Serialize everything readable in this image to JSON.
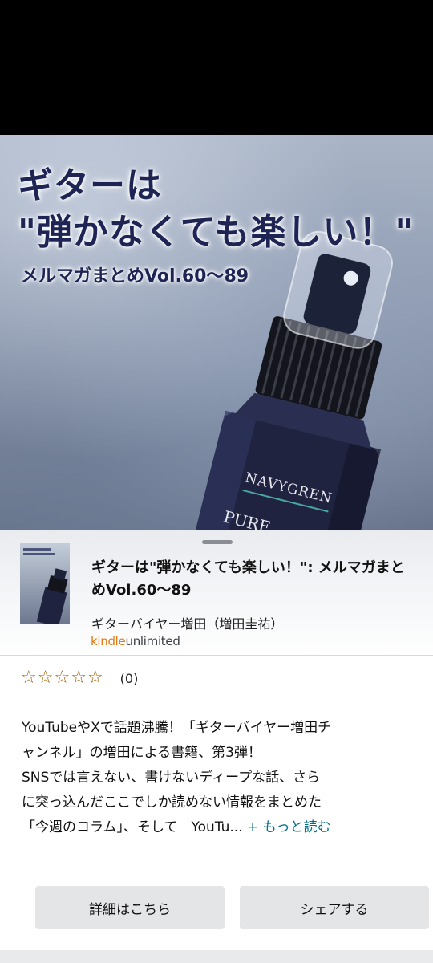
{
  "cover": {
    "title_line1": "ギターは",
    "title_line2": "\"弾かなくても楽しい！\"",
    "subtitle": "メルマガまとめVol.60〜89",
    "bottle_brand": "NAVYGREN",
    "bottle_text_partial": "PURE"
  },
  "book": {
    "title": "ギターは\"弾かなくても楽しい！\": メルマガまとめVol.60〜89",
    "author": "ギターバイヤー増田（増田圭祐）",
    "badge_kindle": "kindle",
    "badge_unlimited": "unlimited"
  },
  "rating": {
    "stars": 0,
    "max_stars": 5,
    "count": "(0)"
  },
  "description": {
    "lines": [
      "YouTubeやXで話題沸騰！「ギターバイヤー増田チ",
      "ャンネル」の増田による書籍、第3弾！",
      "SNSでは言えない、書けないディープな話、さら",
      "に突っ込んだここでしか読めない情報をまとめた",
      "「今週のコラム」、そして　YouTu..."
    ],
    "more": "+ もっと読む"
  },
  "buttons": {
    "detail": "詳細はこちら",
    "share": "シェアする"
  },
  "colors": {
    "kindle_orange": "#e47911",
    "link_teal": "#007185",
    "star_brown": "#a05f00",
    "title_navy": "#1e2454"
  }
}
